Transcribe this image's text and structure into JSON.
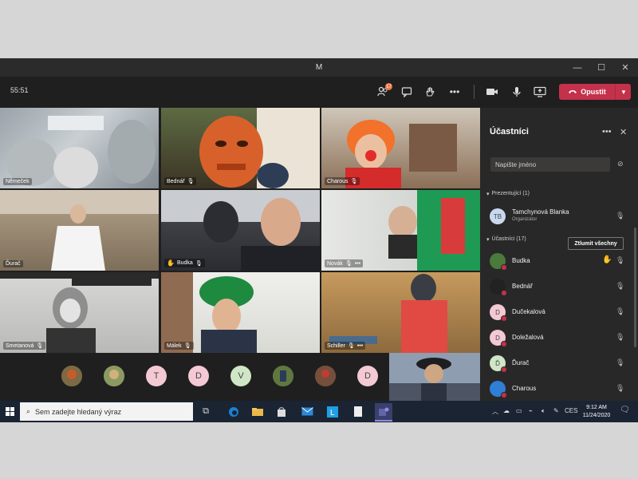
{
  "window": {
    "title": "M"
  },
  "toolbar": {
    "timer": "55:51",
    "participants_badge": "17",
    "leave_label": "Opustit"
  },
  "tiles": [
    {
      "name": "Němeček"
    },
    {
      "name": "Bednář"
    },
    {
      "name": "Charous"
    },
    {
      "name": "Ďurač"
    },
    {
      "name": "Budka"
    },
    {
      "name": "Novák"
    },
    {
      "name": "Smetanová"
    },
    {
      "name": "Málek"
    },
    {
      "name": "Schiller"
    }
  ],
  "avatar_row": [
    "T",
    "D",
    "V",
    "D"
  ],
  "panel": {
    "title": "Účastníci",
    "search_placeholder": "Napište jméno",
    "presenters_header": "Prezentující (1)",
    "mute_all": "Ztlumit všechny",
    "attendees_header": "Účastníci (17)",
    "presenter": {
      "initials": "TB",
      "name": "Tamchynová Blanka",
      "role": "Organizátor"
    },
    "attendees": [
      {
        "name": "Budka",
        "initials": ""
      },
      {
        "name": "Bednář",
        "initials": ""
      },
      {
        "name": "Dučekalová",
        "initials": "D"
      },
      {
        "name": "Doležalová",
        "initials": "D"
      },
      {
        "name": "Ďurač",
        "initials": "Ď"
      },
      {
        "name": "Charous",
        "initials": ""
      }
    ]
  },
  "taskbar": {
    "search_placeholder": "Sem zadejte hledaný výraz",
    "lang": "CES",
    "time": "9:12 AM",
    "date": "11/24/2020"
  },
  "colors": {
    "leave": "#c4314b",
    "badge": "#e97548",
    "avatar_pink": "#f3c9d4",
    "avatar_green": "#cfe6c7",
    "taskbar": "#1b2433"
  }
}
